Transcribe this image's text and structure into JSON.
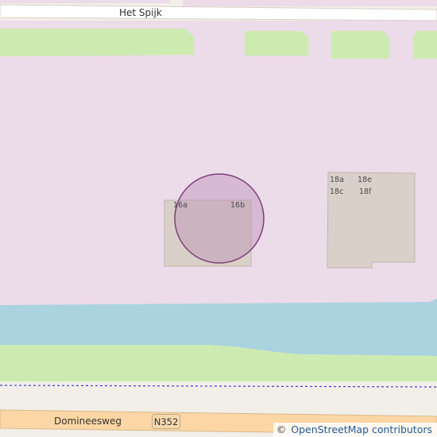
{
  "map": {
    "streets": {
      "top": "Het Spijk",
      "bottom": "Domineesweg"
    },
    "route_shield": "N352",
    "house_numbers": {
      "left_a": "16a",
      "left_b": "16b",
      "right_a": "18a",
      "right_e": "18e",
      "right_c": "18c",
      "right_f": "18f"
    },
    "attribution": {
      "symbol": "©",
      "text": "OpenStreetMap contributors"
    }
  },
  "colors": {
    "background": "#f2efe9",
    "residential_area": "#ecdbe9",
    "grass": "#cdebb0",
    "water": "#aad3df",
    "building": "#d9d0c9",
    "building_outline": "#c4b6ab",
    "road_major": "#fcd6a4",
    "road_minor": "#ffffff",
    "boundary_dashed": "#3c3cd2",
    "marker_fill": "#b887b4",
    "marker_stroke": "#7c3f7a"
  }
}
